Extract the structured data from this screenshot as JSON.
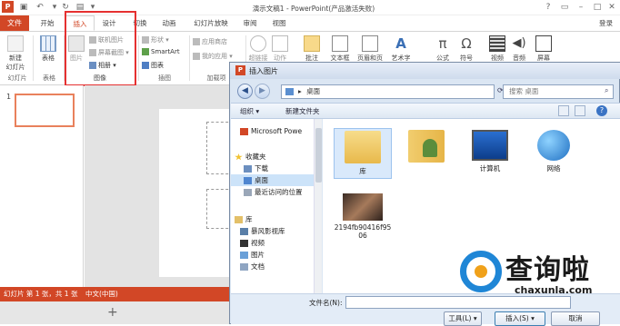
{
  "app": {
    "logo_text": "P",
    "window_title": "演示文稿1 - PowerPoint(产品激活失败)",
    "login": "登录"
  },
  "tabs": [
    "文件",
    "开始",
    "插入",
    "设计",
    "切换",
    "动画",
    "幻灯片放映",
    "审阅",
    "视图"
  ],
  "ribbon": {
    "new_slide": "新建\n幻灯片",
    "new_slide_l1": "新建",
    "new_slide_l2": "幻灯片",
    "table": "表格",
    "picture": "图片",
    "online_picture": "联机图片",
    "screenshot": "屏幕截图",
    "album": "相册",
    "shapes": "形状",
    "smartart": "SmartArt",
    "chart": "图表",
    "app_store": "应用商店",
    "my_apps": "我的应用",
    "hyperlink": "超链接",
    "action": "动作",
    "comment": "批注",
    "textbox": "文本框",
    "header_footer": "页眉和页脚",
    "wordart": "艺术字",
    "equation": "公式",
    "symbol": "符号",
    "video": "视频",
    "audio": "音频",
    "screen_record": "屏幕",
    "groups": {
      "slides": "幻灯片",
      "tables": "表格",
      "images": "图像",
      "illustrations": "插图",
      "addins": "加载项"
    }
  },
  "slides_pane": {
    "slide_number": "1"
  },
  "status_bar": {
    "slide_info": "幻灯片 第 1 张，共 1 张",
    "language": "中文(中国)"
  },
  "bottom": {
    "add": "+"
  },
  "dialog": {
    "title": "插入图片",
    "address": "桌面",
    "address_sep": "▸",
    "search_placeholder": "搜索 桌面",
    "toolbar": {
      "organize": "组织 ▾",
      "new_folder": "新建文件夹"
    },
    "nav": [
      {
        "label": "Microsoft Powe",
        "icon": "powerpoint-icon",
        "indent": 1
      },
      {
        "label": "收藏夹",
        "icon": "star-icon",
        "indent": 0
      },
      {
        "label": "下载",
        "icon": "download-folder-icon",
        "indent": 2
      },
      {
        "label": "桌面",
        "icon": "desktop-icon",
        "indent": 2,
        "selected": true
      },
      {
        "label": "最近访问的位置",
        "icon": "recent-places-icon",
        "indent": 2
      },
      {
        "label": "库",
        "icon": "library-icon",
        "indent": 0
      },
      {
        "label": "暴风影视库",
        "icon": "video-library-icon",
        "indent": 1
      },
      {
        "label": "视频",
        "icon": "video-folder-icon",
        "indent": 1
      },
      {
        "label": "图片",
        "icon": "pictures-folder-icon",
        "indent": 1
      },
      {
        "label": "文档",
        "icon": "documents-folder-icon",
        "indent": 1
      }
    ],
    "files": [
      {
        "label": "库",
        "icon": "library-folder-icon",
        "selected": true
      },
      {
        "label": "",
        "icon": "user-folder-icon"
      },
      {
        "label": "计算机",
        "icon": "computer-icon"
      },
      {
        "label": "网络",
        "icon": "network-icon"
      },
      {
        "label": "2194fb90416f9506",
        "label_l1": "2194fb90416f95",
        "label_l2": "06",
        "icon": "image-thumbnail-icon"
      }
    ],
    "filename_label": "文件名(N):",
    "filename_value": "",
    "tools": "工具(L)",
    "insert": "插入(S)",
    "cancel": "取消"
  },
  "watermark": {
    "brand": "查询啦",
    "url": "chaxunla.com"
  },
  "colors": {
    "accent": "#d24726",
    "highlight": "#e53030",
    "selection": "#cce3f9"
  }
}
